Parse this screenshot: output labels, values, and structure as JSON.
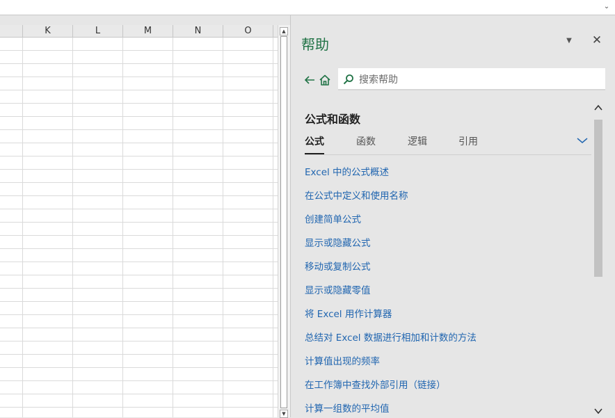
{
  "sheet": {
    "columns": [
      "K",
      "L",
      "M",
      "N",
      "O"
    ]
  },
  "help": {
    "title": "帮助",
    "search": {
      "placeholder": "搜索帮助",
      "value": ""
    },
    "section_title": "公式和函数",
    "tabs": [
      {
        "label": "公式",
        "active": true
      },
      {
        "label": "函数",
        "active": false
      },
      {
        "label": "逻辑",
        "active": false
      },
      {
        "label": "引用",
        "active": false
      }
    ],
    "links": [
      "Excel 中的公式概述",
      "在公式中定义和使用名称",
      "创建简单公式",
      "显示或隐藏公式",
      "移动或复制公式",
      "显示或隐藏零值",
      "将 Excel 用作计算器",
      "总结对 Excel 数据进行相加和计数的方法",
      "计算值出现的频率",
      "在工作簿中查找外部引用（链接）",
      "计算一组数的平均值"
    ],
    "icons": {
      "back": "arrow-left-icon",
      "home": "home-icon",
      "search": "search-icon",
      "close": "close-icon",
      "options": "caret-down-icon",
      "tabs_more": "chevron-down-icon"
    },
    "colors": {
      "accent": "#217346",
      "link": "#2166b0",
      "pane_bg": "#e6e6e6"
    }
  }
}
